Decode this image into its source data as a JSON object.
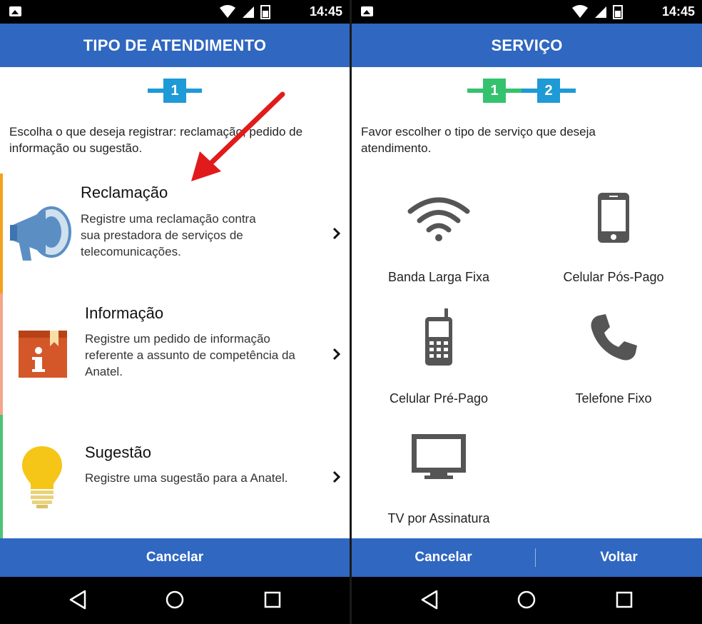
{
  "status_bar": {
    "time": "14:45"
  },
  "left_screen": {
    "header_title": "TIPO DE ATENDIMENTO",
    "steps": [
      "1"
    ],
    "instruction_line1": "Escolha o que deseja registrar: reclamação, pedido de",
    "instruction_line2": "informação ou sugestão.",
    "options": [
      {
        "title": "Reclamação",
        "desc": [
          "Registre uma reclamação contra",
          "sua prestadora de serviços de",
          "telecomunicações."
        ],
        "icon": "megaphone-icon",
        "accent": "#f2a31b"
      },
      {
        "title": "Informação",
        "desc": [
          "Registre um pedido de informação",
          "referente a assunto de competência da",
          "Anatel."
        ],
        "icon": "info-book-icon",
        "accent": "#f4a58a"
      },
      {
        "title": "Sugestão",
        "desc": [
          "Registre uma sugestão para a Anatel."
        ],
        "icon": "lightbulb-icon",
        "accent": "#4cc477"
      }
    ],
    "cancel_label": "Cancelar"
  },
  "right_screen": {
    "header_title": "SERVIÇO",
    "steps": [
      "1",
      "2"
    ],
    "instruction_line1": "Favor escolher o tipo de serviço que deseja",
    "instruction_line2": "atendimento.",
    "services": [
      {
        "label": "Banda Larga Fixa",
        "icon": "wifi-icon"
      },
      {
        "label": "Celular Pós-Pago",
        "icon": "smartphone-icon"
      },
      {
        "label": "Celular Pré-Pago",
        "icon": "mobile-phone-icon"
      },
      {
        "label": "Telefone Fixo",
        "icon": "phone-handset-icon"
      },
      {
        "label": "TV por Assinatura",
        "icon": "tv-icon"
      }
    ],
    "cancel_label": "Cancelar",
    "back_label": "Voltar"
  },
  "colors": {
    "header_blue": "#2f67c1",
    "step_blue": "#1e9ad6",
    "step_green": "#35c26e",
    "annotation_red": "#e11b1b"
  }
}
